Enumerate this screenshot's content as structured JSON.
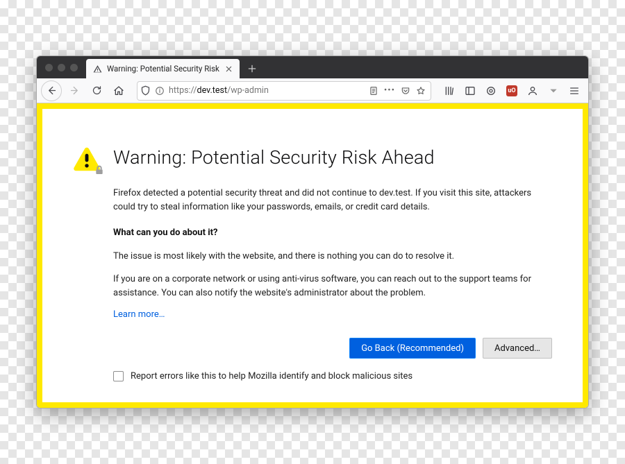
{
  "tab": {
    "title": "Warning: Potential Security Risk"
  },
  "address": {
    "scheme": "https://",
    "host": "dev.test",
    "path": "/wp-admin"
  },
  "toolbar_icons": {
    "ublock_label": "uO"
  },
  "warning": {
    "heading": "Warning: Potential Security Risk Ahead",
    "intro": "Firefox detected a potential security threat and did not continue to dev.test. If you visit this site, attackers could try to steal information like your passwords, emails, or credit card details.",
    "subhead": "What can you do about it?",
    "p1": "The issue is most likely with the website, and there is nothing you can do to resolve it.",
    "p2": "If you are on a corporate network or using anti-virus software, you can reach out to the support teams for assistance. You can also notify the website's administrator about the problem.",
    "learn_more": "Learn more…",
    "btn_primary": "Go Back (Recommended)",
    "btn_secondary": "Advanced…",
    "report_label": "Report errors like this to help Mozilla identify and block malicious sites"
  }
}
